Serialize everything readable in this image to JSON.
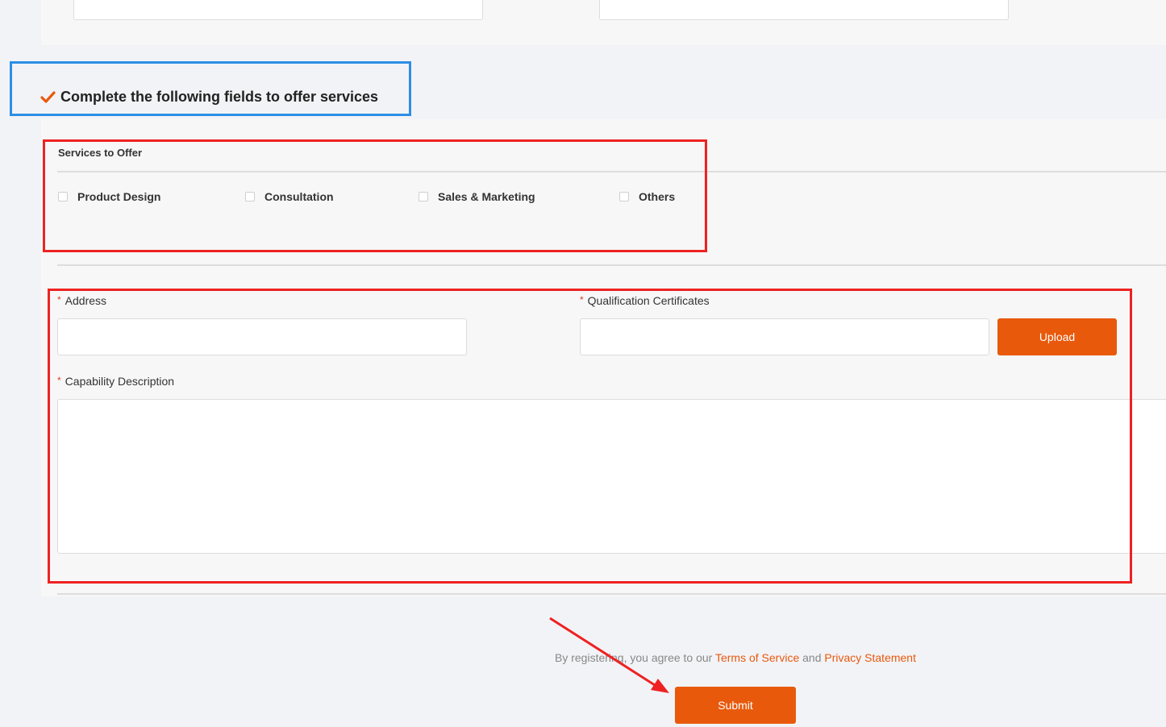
{
  "section": {
    "header": "Complete the following fields to offer services"
  },
  "services": {
    "title": "Services to Offer",
    "options": [
      "Product Design",
      "Consultation",
      "Sales & Marketing",
      "Others"
    ]
  },
  "form": {
    "required_mark": "*",
    "address_label": "Address",
    "certificates_label": "Qualification Certificates",
    "upload_label": "Upload",
    "capability_label": "Capability Description"
  },
  "footer": {
    "agree_text": "By registering, you agree to our",
    "terms_link": "Terms of Service",
    "and_text": "and",
    "privacy_link": "Privacy Statement",
    "submit_label": "Submit"
  },
  "colors": {
    "accent": "#e8590c",
    "annotation_red": "#ee2222",
    "annotation_blue": "#2d8ee6",
    "page_bg": "#f2f3f7",
    "panel_bg": "#f7f7f7"
  }
}
